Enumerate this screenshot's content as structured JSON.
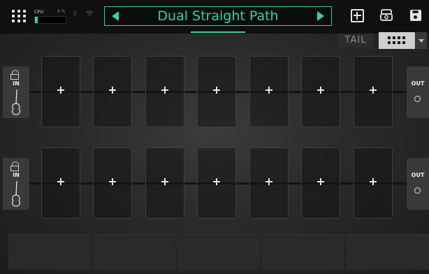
{
  "topbar": {
    "cpu_label": "CPU",
    "cpu_percent_text": "9 %",
    "cpu_level": 0.09,
    "preset_name": "Dual Straight Path",
    "icons": [
      "menu-grid-icon",
      "bluetooth-icon",
      "wifi-icon",
      "prev-arrow-icon",
      "next-arrow-icon",
      "add-block-icon",
      "amp-icon",
      "save-icon"
    ]
  },
  "controls": {
    "tail_label": "TAIL"
  },
  "paths": [
    {
      "in_label": "IN",
      "out_label": "OUT",
      "slots": [
        "+",
        "+",
        "+",
        "+",
        "+",
        "+",
        "+"
      ]
    },
    {
      "in_label": "IN",
      "out_label": "OUT",
      "slots": [
        "+",
        "+",
        "+",
        "+",
        "+",
        "+",
        "+"
      ]
    }
  ],
  "colors": {
    "accent": "#2fd4a7",
    "topbar_bg": "#101010"
  }
}
